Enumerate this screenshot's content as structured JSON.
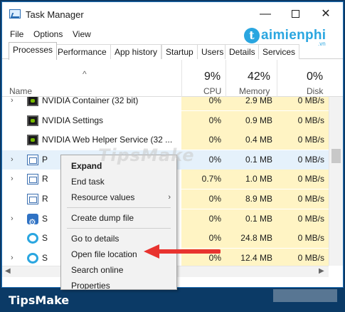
{
  "window": {
    "title": "Task Manager",
    "controls": {
      "minimize": "—",
      "maximize": "□",
      "close": "✕"
    }
  },
  "menubar": [
    "File",
    "Options",
    "View"
  ],
  "watermark_logo": {
    "letter": "t",
    "text": "aimienphi",
    "sub": ".vn"
  },
  "watermark_mid": "TipsMake",
  "tabs": [
    {
      "label": "Processes",
      "active": true
    },
    {
      "label": "Performance"
    },
    {
      "label": "App history"
    },
    {
      "label": "Startup"
    },
    {
      "label": "Users"
    },
    {
      "label": "Details"
    },
    {
      "label": "Services"
    }
  ],
  "columns": {
    "sort_indicator": "^",
    "name": "Name",
    "cpu": {
      "pct": "9%",
      "label": "CPU"
    },
    "memory": {
      "pct": "42%",
      "label": "Memory"
    },
    "disk": {
      "pct": "0%",
      "label": "Disk"
    }
  },
  "processes": [
    {
      "expand": "›",
      "icon": "nvidia-icon",
      "name": "NVIDIA Container (32 bit)",
      "cpu": "0%",
      "mem": "2.9 MB",
      "disk": "0 MB/s"
    },
    {
      "expand": "",
      "icon": "nvidia-icon",
      "name": "NVIDIA Settings",
      "cpu": "0%",
      "mem": "0.9 MB",
      "disk": "0 MB/s"
    },
    {
      "expand": "",
      "icon": "nvidia-icon",
      "name": "NVIDIA Web Helper Service (32 ...",
      "cpu": "0%",
      "mem": "0.4 MB",
      "disk": "0 MB/s"
    },
    {
      "expand": "›",
      "icon": "window-icon",
      "name": "P",
      "cpu": "0%",
      "mem": "0.1 MB",
      "disk": "0 MB/s",
      "selected": true
    },
    {
      "expand": "›",
      "icon": "window-icon",
      "name": "R",
      "cpu": "0.7%",
      "mem": "1.0 MB",
      "disk": "0 MB/s"
    },
    {
      "expand": "",
      "icon": "window-icon",
      "name": "R",
      "cpu": "0%",
      "mem": "8.9 MB",
      "disk": "0 MB/s"
    },
    {
      "expand": "›",
      "icon": "gear-icon",
      "name": "S",
      "cpu": "0%",
      "mem": "0.1 MB",
      "disk": "0 MB/s"
    },
    {
      "expand": "",
      "icon": "ring-icon",
      "name": "S",
      "cpu": "0%",
      "mem": "24.8 MB",
      "disk": "0 MB/s"
    },
    {
      "expand": "›",
      "icon": "ring-icon",
      "name": "S",
      "cpu": "0%",
      "mem": "12.4 MB",
      "disk": "0 MB/s"
    }
  ],
  "context_menu": [
    {
      "label": "Expand",
      "bold": true
    },
    {
      "label": "End task"
    },
    {
      "label": "Resource values",
      "submenu": true
    },
    {
      "separator": true
    },
    {
      "label": "Create dump file"
    },
    {
      "separator": true
    },
    {
      "label": "Go to details"
    },
    {
      "label": "Open file location"
    },
    {
      "label": "Search online"
    },
    {
      "label": "Properties"
    }
  ],
  "footer": {
    "brand": "TipsMake"
  },
  "colors": {
    "highlight_arrow": "#e8332f",
    "cpu_bg": "#fff4c4",
    "selected_bg": "#e5f1fb",
    "footer_bg": "#0b3a66"
  }
}
